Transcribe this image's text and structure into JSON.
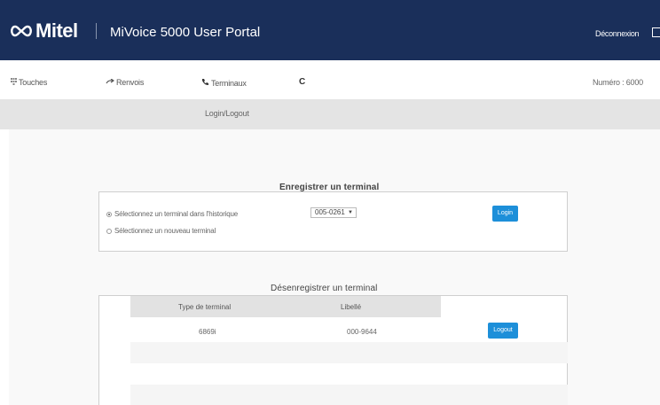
{
  "header": {
    "brand": "Mitel",
    "title": "MiVoice 5000 User Portal",
    "logout": "Déconnexion"
  },
  "nav": {
    "items": [
      {
        "label": "Touches",
        "icon": "keypad-icon"
      },
      {
        "label": "Renvois",
        "icon": "forward-arrow-icon"
      },
      {
        "label": "Terminaux",
        "icon": "phone-icon"
      }
    ],
    "active_partial": "C",
    "number": "Numéro : 6000"
  },
  "subnav": {
    "item": "Login/Logout"
  },
  "register": {
    "title": "Enregistrer un terminal",
    "option_history": "Sélectionnez un terminal dans l'historique",
    "option_new": "Sélectionnez un nouveau terminal",
    "selected_option": "history",
    "select_value": "005-0261",
    "login_button": "Login"
  },
  "unregister": {
    "title": "Désenregistrer un terminal",
    "columns": [
      "Type de terminal",
      "Libellé"
    ],
    "rows": [
      {
        "type": "6869i",
        "label": "000-9644",
        "action": "Logout"
      }
    ]
  },
  "colors": {
    "header_bg": "#1a2f5a",
    "accent": "#1d8fd9",
    "subbar_bg": "#e4e4e4"
  }
}
